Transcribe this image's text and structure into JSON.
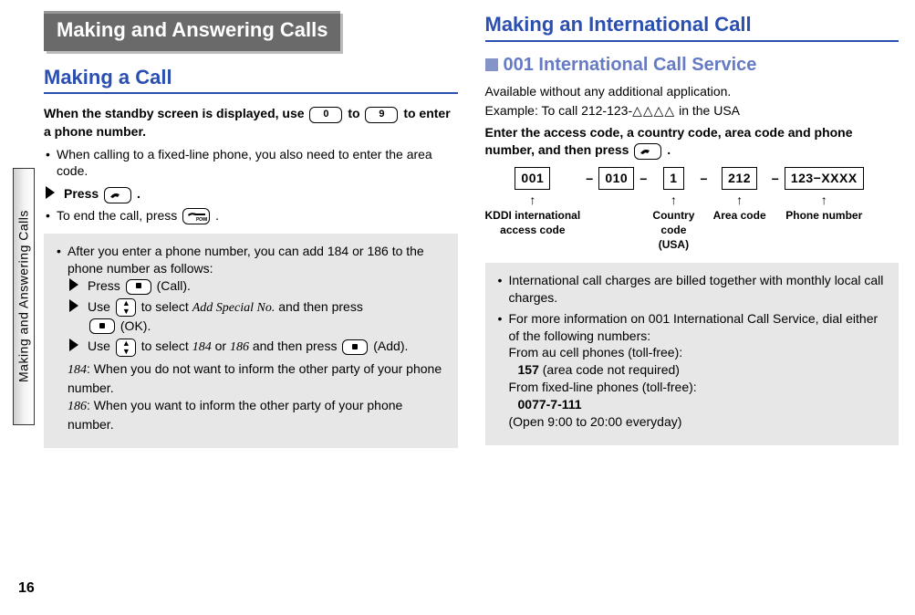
{
  "page_number": "16",
  "side_tab": "Making and Answering Calls",
  "left": {
    "section_title": "Making and Answering Calls",
    "h1": "Making a Call",
    "intro_bold_a": "When the standby screen is displayed, use ",
    "intro_bold_b": " to ",
    "intro_bold_c": " to enter a phone number.",
    "key0": "0",
    "key9": "9",
    "bullet1": "When calling to a fixed-line phone, you also also need to enter the area code.",
    "press_label": "Press ",
    "press_dot": ".",
    "end_call_a": "To end the call, press ",
    "end_call_b": ".",
    "note_intro": "After you enter a phone number, you can add 184 or 186 to the phone number as follows:",
    "note_press_call": "Press ",
    "note_call_label": " (Call).",
    "note_use_a": "Use ",
    "note_select": " to select ",
    "note_addspecial": "Add Special No.",
    "note_then_press": " and then press ",
    "note_ok_label": " (OK).",
    "note_use_b": "Use ",
    "note_184": "184",
    "note_or": " or ",
    "note_186": "186",
    "note_add_label": " (Add).",
    "desc184_a": ": When you do not want to inform the other party of your phone number.",
    "desc186_a": ": When you want to inform the other party of your phone number."
  },
  "right": {
    "h1": "Making an International Call",
    "h2": "001 International Call Service",
    "line1": "Available without any additional application.",
    "line2_a": "Example: To call 212-123-",
    "line2_tri": "△△△△",
    "line2_b": " in the USA",
    "bold_instr_a": "Enter the access code, a country code, area code and phone number, and then press ",
    "bold_instr_b": ".",
    "boxes": {
      "b1": "001",
      "b2": "010",
      "b3": "1",
      "b4": "212",
      "b5": "123−XXXX"
    },
    "labels": {
      "l1a": "KDDI international",
      "l1b": "access code",
      "l3a": "Country",
      "l3b": "code",
      "l3c": "(USA)",
      "l4": "Area code",
      "l5": "Phone number"
    },
    "note_b1": "International call charges are billed together with monthly local call charges.",
    "note_b2": "For more information on 001 International Call Service, dial either of the following numbers:",
    "note_line3": "From au cell phones (toll-free):",
    "note_line4_num": "157",
    "note_line4_rest": " (area code not required)",
    "note_line5": "From fixed-line phones (toll-free):",
    "note_line6": "0077-7-111",
    "note_line7": "(Open 9:00 to 20:00 everyday)"
  }
}
